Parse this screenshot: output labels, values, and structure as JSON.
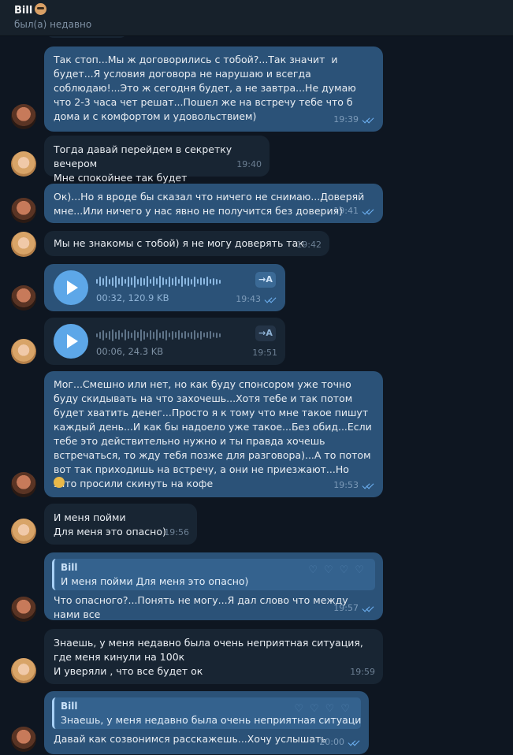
{
  "header": {
    "name": "Bill",
    "status": "был(а) недавно"
  },
  "messages": [
    {
      "text": "Так стоп...Мы ж договорились с тобой?...Так значит  и будет...Я условия договора не нарушаю и всегда соблюдаю!...Это ж сегодня будет, а не завтра...Не думаю что 2-3 часа чет решат...Пошел же на встречу тебе что б дома и с комфортом и удовольствием)",
      "time": "19:39"
    },
    {
      "text": "Тогда давай перейдем в секретку вечером\nМне спокойнее так будет",
      "time": "19:40"
    },
    {
      "text": "Ок)...Но я вроде бы сказал что ничего не снимаю...Доверяй мне...Или ничего у нас явно не получится без доверия)",
      "time": "19:41"
    },
    {
      "text": "Мы не знакомы с тобой) я не могу доверять так",
      "time": "19:42"
    },
    {
      "duration": "00:32, 120.9 KB",
      "time": "19:43",
      "transcribe": "→A"
    },
    {
      "duration": "00:06, 24.3 KB",
      "time": "19:51",
      "transcribe": "→A"
    },
    {
      "text": "Мог...Смешно или нет, но как буду спонсором уже точно буду скидывать на что захочешь...Хотя тебе и так потом будет хватить денег...Просто я к тому что мне такое пишут каждый день...И как бы надоело уже такое...Без обид...Если тебе это действительно нужно и ты правда хочешь встречаться, то жду тебя позже для разговора)...А то потом вот так приходишь на встречу, а они не приезжают...Но зато просили скинуть на кофе",
      "time": "19:53"
    },
    {
      "text": "И меня пойми\nДля меня это опасно)",
      "time": "19:56"
    },
    {
      "reply_name": "Bill",
      "reply_text": "И меня пойми  Для меня это опасно)",
      "text": "Что опасного?...Понять не могу...Я дал слово что между нами все",
      "time": "19:57"
    },
    {
      "text": "Знаешь, у меня недавно была очень неприятная ситуация, где меня кинули на 100к\nИ уверяли , что все будет ок",
      "time": "19:59"
    },
    {
      "reply_name": "Bill",
      "reply_text": "Знаешь, у меня недавно была очень неприятная ситуаци...",
      "text": "Давай как созвонимся расскажешь...Хочу услышать",
      "time": "20:00"
    }
  ]
}
